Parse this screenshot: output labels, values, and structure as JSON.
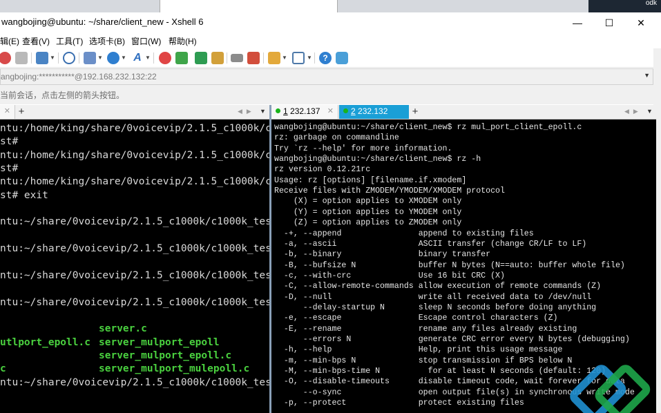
{
  "background_window": {
    "tab_label": "",
    "corner_text": "odk"
  },
  "window": {
    "title": "wangbojing@ubuntu: ~/share/client_new - Xshell 6",
    "min_glyph": "—",
    "max_glyph": "☐",
    "close_glyph": "✕"
  },
  "menu": {
    "items": [
      "编辑(E)",
      "查看(V)",
      "工具(T)",
      "选项卡(B)",
      "窗口(W)",
      "帮助(H)"
    ]
  },
  "toolbar": {
    "icons": [
      "reconnect-icon",
      "disconnect-icon",
      "new-session-icon",
      "find-icon",
      "transfer-icon",
      "globe-icon",
      "font-icon",
      "xftp-icon",
      "xshell-icon",
      "fullscreen-icon",
      "lock-icon",
      "keyboard-icon",
      "highlight-icon",
      "compose-icon",
      "layout-icon",
      "help-icon",
      "chat-icon"
    ]
  },
  "address": {
    "value": "angbojing:***********@192.168.232.132:22"
  },
  "hint": {
    "text": "当前会话，点击左侧的箭头按钮。"
  },
  "left_tabs": {
    "close_glyph": "✕",
    "plus": "+",
    "nav": "◀▶",
    "caret": "▼"
  },
  "right_tabs": {
    "tabs": [
      {
        "number": "1",
        "label": "232.137",
        "status_color": "#19b31a",
        "active": false
      },
      {
        "number": "2",
        "label": "232.132",
        "status_color": "#19b31a",
        "active": true
      }
    ],
    "close_glyph": "✕",
    "plus": "+",
    "nav": "◀▶",
    "caret": "▼"
  },
  "terminal_left": {
    "lines": [
      "ntu:/home/king/share/0voicevip/2.1.5_c1000k/c",
      "st#",
      "ntu:/home/king/share/0voicevip/2.1.5_c1000k/c",
      "st#",
      "ntu:/home/king/share/0voicevip/2.1.5_c1000k/c",
      "st# exit",
      "",
      "ntu:~/share/0voicevip/2.1.5_c1000k/c1000k_tes",
      "",
      "ntu:~/share/0voicevip/2.1.5_c1000k/c1000k_tes",
      "",
      "ntu:~/share/0voicevip/2.1.5_c1000k/c1000k_tes",
      "",
      "ntu:~/share/0voicevip/2.1.5_c1000k/c1000k_tes",
      "",
      "",
      "",
      "",
      "",
      "ntu:~/share/0voicevip/2.1.5_c1000k/c1000k_tes"
    ],
    "listing": [
      {
        "left": "",
        "right": "server.c"
      },
      {
        "left": "utlport_epoll.c",
        "right": "server_mulport_epoll"
      },
      {
        "left": "",
        "right": "server_mulport_epoll.c"
      },
      {
        "left": "c",
        "right": "server_mulport_mulepoll.c"
      }
    ]
  },
  "terminal_right": {
    "lines": [
      "wangbojing@ubuntu:~/share/client_new$ rz mul_port_client_epoll.c",
      "rz: garbage on commandline",
      "Try `rz --help' for more information.",
      "wangbojing@ubuntu:~/share/client_new$ rz -h",
      "rz version 0.12.21rc",
      "Usage: rz [options] [filename.if.xmodem]",
      "Receive files with ZMODEM/YMODEM/XMODEM protocol",
      "    (X) = option applies to XMODEM only",
      "    (Y) = option applies to YMODEM only",
      "    (Z) = option applies to ZMODEM only",
      "  -+, --append                append to existing files",
      "  -a, --ascii                 ASCII transfer (change CR/LF to LF)",
      "  -b, --binary                binary transfer",
      "  -B, --bufsize N             buffer N bytes (N==auto: buffer whole file)",
      "  -c, --with-crc              Use 16 bit CRC (X)",
      "  -C, --allow-remote-commands allow execution of remote commands (Z)",
      "  -D, --null                  write all received data to /dev/null",
      "      --delay-startup N       sleep N seconds before doing anything",
      "  -e, --escape                Escape control characters (Z)",
      "  -E, --rename                rename any files already existing",
      "      --errors N              generate CRC error every N bytes (debugging)",
      "  -h, --help                  Help, print this usage message",
      "  -m, --min-bps N             stop transmission if BPS below N",
      "  -M, --min-bps-time N          for at least N seconds (default: 120)",
      "  -O, --disable-timeouts      disable timeout code, wait forever for data",
      "      --o-sync                open output file(s) in synchronous write mode",
      "  -p, --protect               protect existing files"
    ]
  },
  "colors": {
    "terminal_bg": "#000000",
    "terminal_fg": "#e6e6e6",
    "listing_green": "#4ad13f",
    "status_green": "#19b31a",
    "active_tab_bg": "#1a9fd6",
    "watermark_blue": "#1f8fd0",
    "watermark_green": "#1ea64a"
  }
}
